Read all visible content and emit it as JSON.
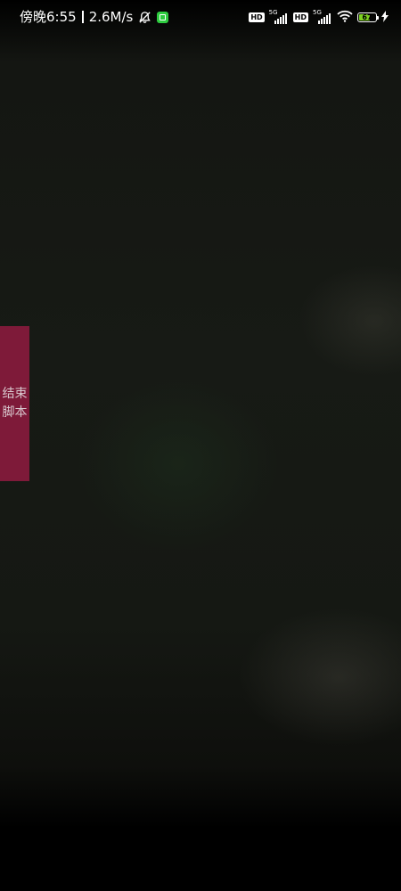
{
  "status_bar": {
    "time": "傍晚6:55",
    "net_speed": "2.6M/s",
    "icons": {
      "silent": "bell-off-icon",
      "app": "app-notification-icon",
      "hd1": "HD",
      "hd2": "HD",
      "sig1_type": "5G",
      "sig2_type": "5G",
      "wifi": "wifi-icon",
      "charging": "lightning-icon"
    },
    "battery_level": "67",
    "battery_fraction": 0.67
  },
  "floating_button": {
    "label": "结束脚本",
    "color": "#7e1a39"
  }
}
